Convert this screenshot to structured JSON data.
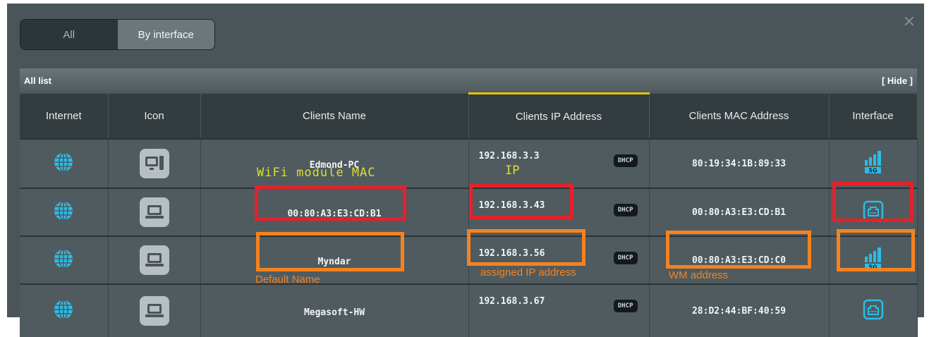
{
  "tabs": {
    "all": "All",
    "by_interface": "By interface"
  },
  "list": {
    "title": "All list",
    "hide": "[ Hide ]"
  },
  "columns": [
    "Internet",
    "Icon",
    "Clients Name",
    "Clients IP Address",
    "Clients MAC Address",
    "Interface"
  ],
  "rows": [
    {
      "name": "Edmond-PC",
      "ip": "192.168.3.3",
      "mode": "DHCP",
      "mac": "80:19:34:1B:89:33",
      "device": "desktop-icon",
      "interface": "5G"
    },
    {
      "name": "00:80:A3:E3:CD:B1",
      "ip": "192.168.3.43",
      "mode": "DHCP",
      "mac": "00:80:A3:E3:CD:B1",
      "device": "laptop-icon",
      "interface": "wired"
    },
    {
      "name": "Myndar",
      "ip": "192.168.3.56",
      "mode": "DHCP",
      "mac": "00:80:A3:E3:CD:C0",
      "device": "laptop-icon",
      "interface": "5G"
    },
    {
      "name": "Megasoft-HW",
      "ip": "192.168.3.67",
      "mode": "DHCP",
      "mac": "28:D2:44:BF:40:59",
      "device": "laptop-icon",
      "interface": "wired"
    }
  ],
  "annotations": {
    "wifi_mac": "WiFi module MAC",
    "ip": "IP",
    "default_name": "Default Name",
    "assigned_ip": "assigned IP address",
    "wm_address": "WM address"
  },
  "colors": {
    "panel": "#4a5559",
    "header": "#333c3f",
    "red_box": "#e8202a",
    "orange_box": "#f58220",
    "annotation_yellow": "#dede30",
    "annotation_orange": "#f58220",
    "wifi_blue": "#2bbde8",
    "sort_indicator": "#e6c300"
  }
}
